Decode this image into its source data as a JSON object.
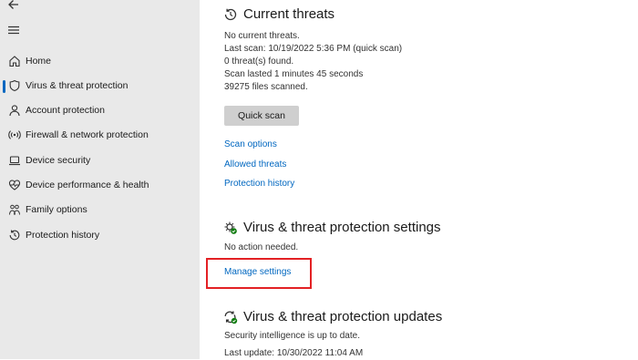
{
  "nav": {
    "items": [
      {
        "label": "Home",
        "icon": "home-icon"
      },
      {
        "label": "Virus & threat protection",
        "icon": "shield-icon",
        "active": true
      },
      {
        "label": "Account protection",
        "icon": "person-icon"
      },
      {
        "label": "Firewall & network protection",
        "icon": "wifi-icon"
      },
      {
        "label": "Device security",
        "icon": "laptop-icon"
      },
      {
        "label": "Device performance & health",
        "icon": "heart-icon"
      },
      {
        "label": "Family options",
        "icon": "family-icon"
      },
      {
        "label": "Protection history",
        "icon": "history-icon"
      }
    ]
  },
  "current_threats": {
    "title": "Current threats",
    "status": "No current threats.",
    "last_scan": "Last scan: 10/19/2022 5:36 PM (quick scan)",
    "threats_found": "0 threat(s) found.",
    "scan_duration": "Scan lasted 1 minutes 45 seconds",
    "files_scanned": "39275 files scanned.",
    "quick_scan_label": "Quick scan",
    "links": {
      "scan_options": "Scan options",
      "allowed_threats": "Allowed threats",
      "protection_history": "Protection history"
    }
  },
  "settings": {
    "title": "Virus & threat protection settings",
    "status": "No action needed.",
    "manage_link": "Manage settings"
  },
  "updates": {
    "title": "Virus & threat protection updates",
    "status": "Security intelligence is up to date.",
    "last_update": "Last update: 10/30/2022 11:04 AM"
  },
  "colors": {
    "sidebar_bg": "#e9e9e9",
    "link": "#0067c0",
    "highlight_box": "#e32124",
    "status_ok": "#107c10"
  }
}
